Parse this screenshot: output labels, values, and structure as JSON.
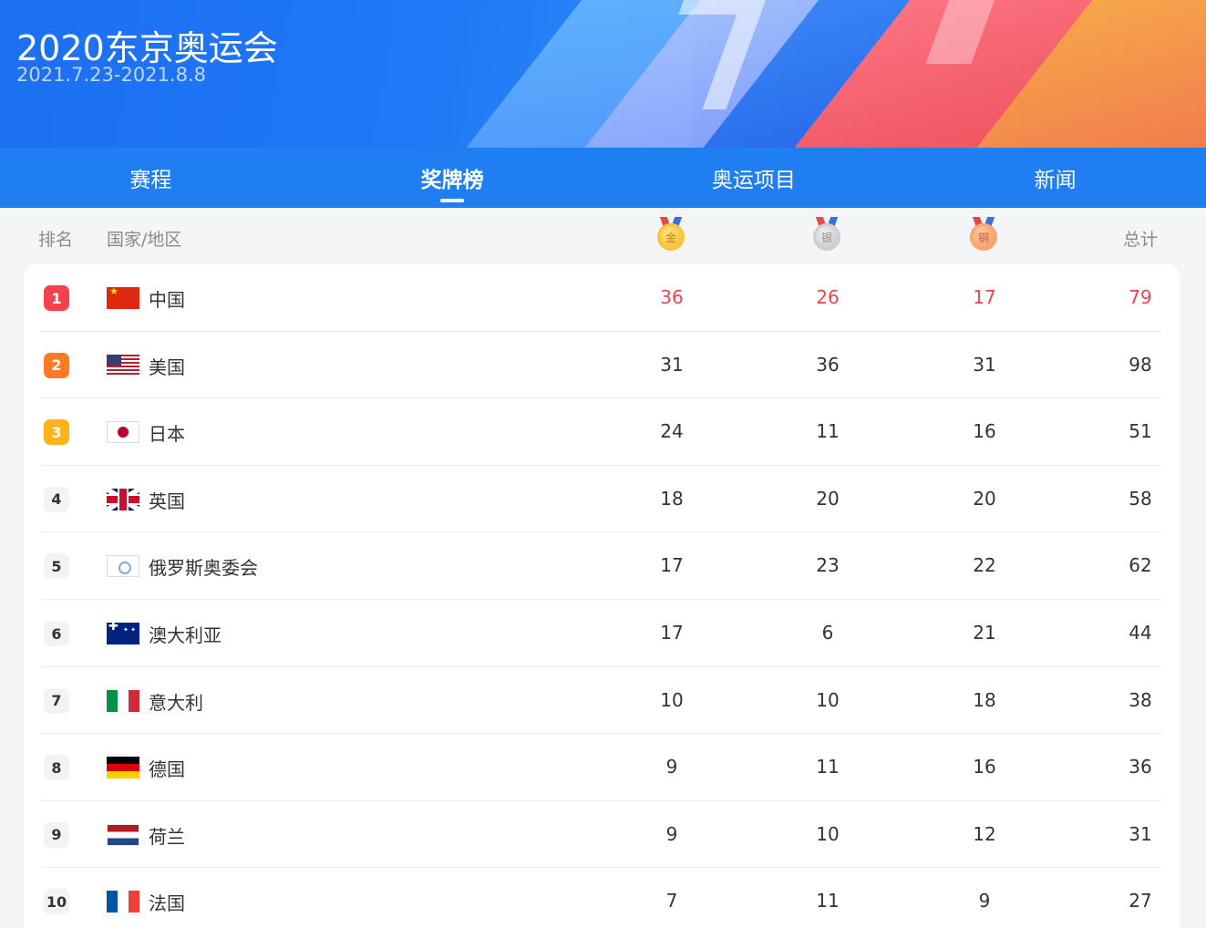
{
  "header": {
    "title": "2020东京奥运会",
    "dates": "2021.7.23-2021.8.8"
  },
  "tabs": [
    {
      "label": "赛程",
      "active": false
    },
    {
      "label": "奖牌榜",
      "active": true
    },
    {
      "label": "奥运项目",
      "active": false
    },
    {
      "label": "新闻",
      "active": false
    }
  ],
  "columns": {
    "rank": "排名",
    "country": "国家/地区",
    "gold_icon_text": "金",
    "silver_icon_text": "银",
    "bronze_icon_text": "铜",
    "total": "总计"
  },
  "colors": {
    "accent_blue": "#1f7ff2",
    "highlight_red": "#f2434b",
    "rank2_orange": "#ff7a22",
    "rank3_yellow": "#ffb21a"
  },
  "rows": [
    {
      "rank": "1",
      "country": "中国",
      "flag": "cn-flag-icon",
      "gold": "36",
      "silver": "26",
      "bronze": "17",
      "total": "79"
    },
    {
      "rank": "2",
      "country": "美国",
      "flag": "us-flag-icon",
      "gold": "31",
      "silver": "36",
      "bronze": "31",
      "total": "98"
    },
    {
      "rank": "3",
      "country": "日本",
      "flag": "jp-flag-icon",
      "gold": "24",
      "silver": "11",
      "bronze": "16",
      "total": "51"
    },
    {
      "rank": "4",
      "country": "英国",
      "flag": "gb-flag-icon",
      "gold": "18",
      "silver": "20",
      "bronze": "20",
      "total": "58"
    },
    {
      "rank": "5",
      "country": "俄罗斯奥委会",
      "flag": "roc-flag-icon",
      "gold": "17",
      "silver": "23",
      "bronze": "22",
      "total": "62"
    },
    {
      "rank": "6",
      "country": "澳大利亚",
      "flag": "au-flag-icon",
      "gold": "17",
      "silver": "6",
      "bronze": "21",
      "total": "44"
    },
    {
      "rank": "7",
      "country": "意大利",
      "flag": "it-flag-icon",
      "gold": "10",
      "silver": "10",
      "bronze": "18",
      "total": "38"
    },
    {
      "rank": "8",
      "country": "德国",
      "flag": "de-flag-icon",
      "gold": "9",
      "silver": "11",
      "bronze": "16",
      "total": "36"
    },
    {
      "rank": "9",
      "country": "荷兰",
      "flag": "nl-flag-icon",
      "gold": "9",
      "silver": "10",
      "bronze": "12",
      "total": "31"
    },
    {
      "rank": "10",
      "country": "法国",
      "flag": "fr-flag-icon",
      "gold": "7",
      "silver": "11",
      "bronze": "9",
      "total": "27"
    }
  ]
}
